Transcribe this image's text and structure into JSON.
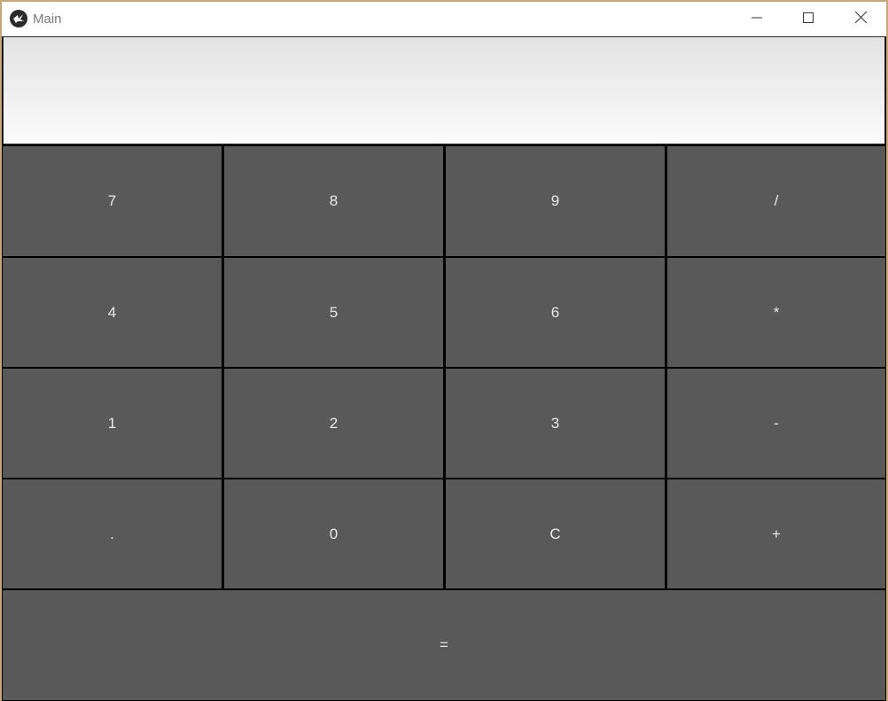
{
  "window": {
    "title": "Main",
    "app_icon": "kivy-logo-icon",
    "controls": {
      "minimize": "minimize-icon",
      "maximize": "maximize-icon",
      "close": "close-icon"
    }
  },
  "display": {
    "value": ""
  },
  "keypad": {
    "rows": [
      [
        "7",
        "8",
        "9",
        "/"
      ],
      [
        "4",
        "5",
        "6",
        "*"
      ],
      [
        "1",
        "2",
        "3",
        "-"
      ],
      [
        ".",
        "0",
        "C",
        "+"
      ]
    ],
    "equals": "="
  },
  "colors": {
    "key_background": "#595959",
    "key_text": "#e9e9e9",
    "display_top": "#e3e3e3",
    "display_bottom": "#fbfbfb",
    "titlebar": "#ffffff",
    "title_text": "#7a7a7a"
  }
}
